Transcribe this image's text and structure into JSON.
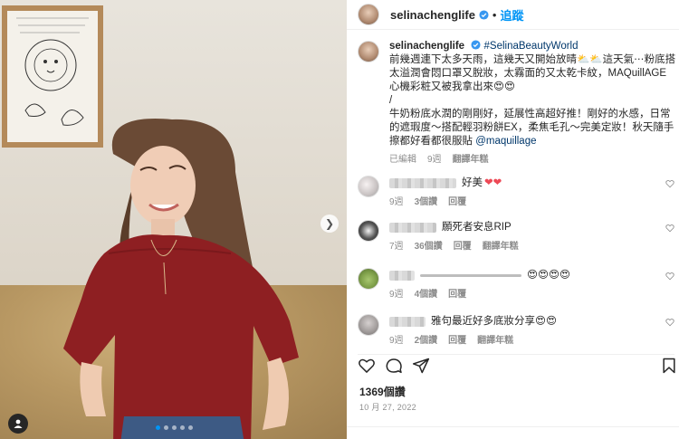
{
  "post": {
    "username": "selinachenglife",
    "separator": "•",
    "follow_label": "追蹤",
    "caption": {
      "username": "selinachenglife",
      "hashtag": "#SelinaBeautyWorld",
      "line1": "前幾週連下太多天雨，這幾天又開始放晴",
      "line1b": "這天氣⋯粉底搭太溢潤會悶口罩又脫妝，太霧面的又太乾卡紋，MAQuillAGE心機彩粧又被我拿出來",
      "slash": "/",
      "line2": "牛奶粉底水潤的剛剛好，延展性高超好推！剛好的水感，日常的遮瑕度～搭配輕羽粉餅EX，柔焦毛孔～完美定妝！秋天隨手擦都好看都很服貼",
      "mention": "@maquillage",
      "edited": "已編輯",
      "time": "9週",
      "translate": "翻譯年糕"
    }
  },
  "comments": [
    {
      "text": "好美",
      "hearts": "❤❤",
      "time": "9週",
      "likes": "3個讚",
      "reply": "回覆",
      "translate": ""
    },
    {
      "text": "願死者安息RIP",
      "hearts": "",
      "time": "7週",
      "likes": "36個讚",
      "reply": "回覆",
      "translate": "翻譯年糕"
    },
    {
      "text": "",
      "hearts": "😍😍😍😍",
      "time": "9週",
      "likes": "4個讚",
      "reply": "回覆",
      "translate": ""
    },
    {
      "text": "雅句最近好多底妝分享",
      "hearts": "😍😍",
      "time": "9週",
      "likes": "2個讚",
      "reply": "回覆",
      "translate": "翻譯年糕"
    }
  ],
  "engagement": {
    "likes": "1369個讚",
    "date": "10 月 27, 2022"
  },
  "icons": {
    "heart": "heart-icon",
    "comment": "comment-icon",
    "share": "share-icon",
    "bookmark": "bookmark-icon",
    "next": "chevron-right-icon",
    "user_tag": "user-tag-icon",
    "verified": "verified-badge-icon"
  },
  "colors": {
    "link": "#00376b",
    "follow": "#0095f6",
    "muted": "#8e8e8e",
    "verified": "#3897f0"
  },
  "carousel": {
    "count": 5,
    "active": 1
  }
}
